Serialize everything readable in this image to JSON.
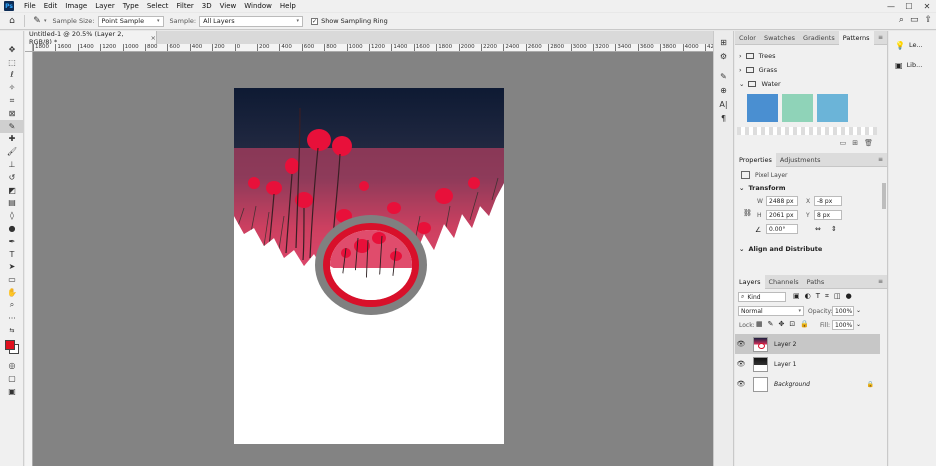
{
  "app": {
    "logo": "Ps",
    "menu": [
      "File",
      "Edit",
      "Image",
      "Layer",
      "Type",
      "Select",
      "Filter",
      "3D",
      "View",
      "Window",
      "Help"
    ],
    "window_controls": [
      "—",
      "☐",
      "✕"
    ]
  },
  "options": {
    "sample_size_label": "Sample Size:",
    "sample_size_value": "Point Sample",
    "sample_label": "Sample:",
    "sample_value": "All Layers",
    "sampling_ring_label": "Show Sampling Ring",
    "sampling_ring_checked": true
  },
  "document": {
    "tab_title": "Untitled-1 @ 20.5% (Layer 2, RGB/8) *",
    "close": "×",
    "ruler_ticks": [
      "1800",
      "1600",
      "1400",
      "1200",
      "1000",
      "800",
      "600",
      "400",
      "200",
      "0",
      "200",
      "400",
      "600",
      "800",
      "1000",
      "1200",
      "1400",
      "1600",
      "1800",
      "2000",
      "2200",
      "2400",
      "2600",
      "2800",
      "3000",
      "3200",
      "3400",
      "3600",
      "3800",
      "4000",
      "4200"
    ]
  },
  "colors": {
    "foreground": "#e0101e",
    "background": "#ffffff",
    "ring_outer": "#808080",
    "ring_inner": "#d8102a"
  },
  "toolbar": {
    "icons": [
      "move-icon",
      "marquee-icon",
      "lasso-icon",
      "quick-select-icon",
      "crop-icon",
      "frame-icon",
      "eyedropper-icon",
      "healing-icon",
      "brush-icon",
      "stamp-icon",
      "history-brush-icon",
      "eraser-icon",
      "gradient-icon",
      "blur-icon",
      "dodge-icon",
      "pen-icon",
      "type-icon",
      "path-select-icon",
      "shape-icon",
      "hand-icon",
      "zoom-icon",
      "more-icon",
      "swap-colors-icon",
      "color-swatches",
      "quick-mask-icon",
      "screen-mode-icon",
      "artboard-icon"
    ],
    "active": "eyedropper-icon"
  },
  "patterns_panel": {
    "tabs": [
      "Color",
      "Swatches",
      "Gradients",
      "Patterns"
    ],
    "active_tab": "Patterns",
    "groups": [
      "Trees",
      "Grass",
      "Water"
    ],
    "swatch_colors": [
      "#4a8fd1",
      "#8fd3b8",
      "#6bb4d8"
    ]
  },
  "properties_panel": {
    "tabs": [
      "Properties",
      "Adjustments"
    ],
    "active_tab": "Properties",
    "kind": "Pixel Layer",
    "transform_title": "Transform",
    "w_label": "W",
    "w_value": "2488 px",
    "h_label": "H",
    "h_value": "2061 px",
    "x_label": "X",
    "x_value": "-8 px",
    "y_label": "Y",
    "y_value": "8 px",
    "angle_value": "0.00°",
    "align_title": "Align and Distribute"
  },
  "layers_panel": {
    "tabs": [
      "Layers",
      "Channels",
      "Paths"
    ],
    "active_tab": "Layers",
    "kind_filter": "Kind",
    "blend_mode": "Normal",
    "opacity_label": "Opacity:",
    "opacity_value": "100%",
    "lock_label": "Lock:",
    "fill_label": "Fill:",
    "fill_value": "100%",
    "layers": [
      {
        "name": "Layer 2",
        "selected": true
      },
      {
        "name": "Layer 1",
        "selected": false
      },
      {
        "name": "Background",
        "selected": false,
        "locked": true
      }
    ]
  },
  "right_strip": {
    "items": [
      "Le...",
      "Lib..."
    ]
  }
}
